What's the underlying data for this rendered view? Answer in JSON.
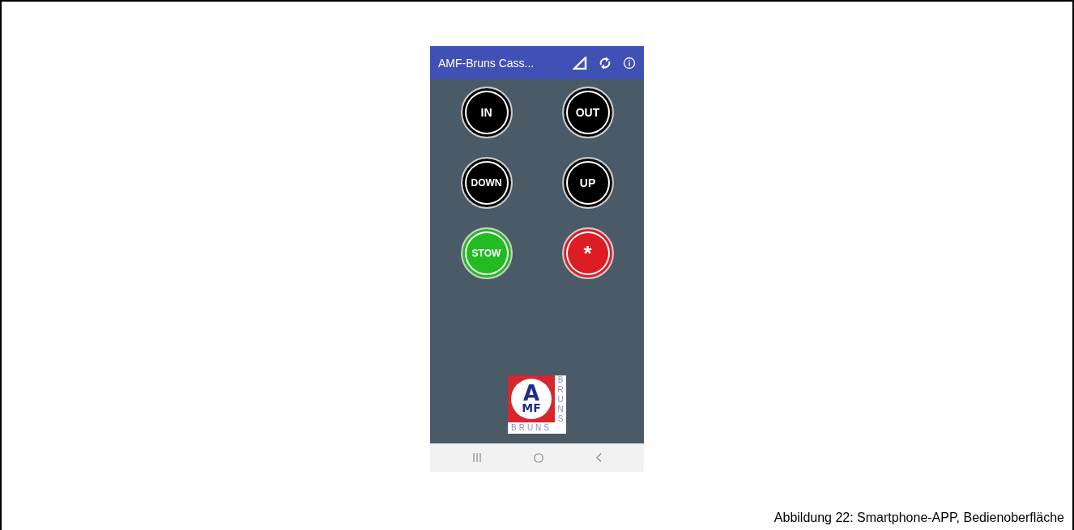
{
  "app_bar": {
    "title": "AMF-Bruns Cass..."
  },
  "buttons": [
    {
      "label": "IN",
      "color": "#000000"
    },
    {
      "label": "OUT",
      "color": "#000000"
    },
    {
      "label": "DOWN",
      "color": "#000000"
    },
    {
      "label": "UP",
      "color": "#000000"
    },
    {
      "label": "STOW",
      "color": "#22bb22"
    },
    {
      "label": "*",
      "color": "#dd1c24"
    }
  ],
  "logo": {
    "mark_top": "A",
    "mark_bottom": "MF",
    "side_text": "BRUNS",
    "bottom_text": "BRUNS"
  },
  "caption": "Abbildung 22: Smartphone-APP, Bedienoberfläche"
}
